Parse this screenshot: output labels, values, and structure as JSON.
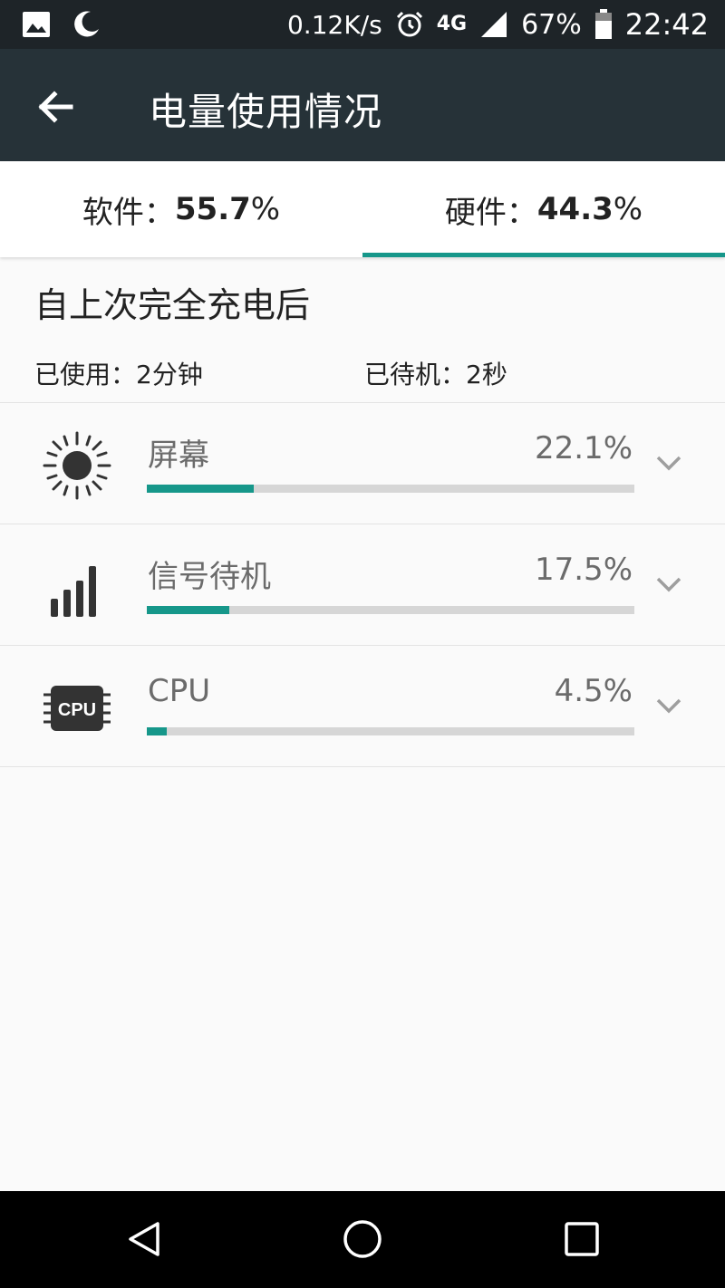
{
  "status_bar": {
    "net_speed": "0.12K/s",
    "network_type": "4G",
    "battery": "67%",
    "time": "22:42",
    "icons": [
      "image-icon",
      "moon-icon",
      "alarm-icon",
      "4g-icon",
      "signal-icon",
      "battery-icon"
    ]
  },
  "app_bar": {
    "title": "电量使用情况",
    "back_icon": "arrow-left-icon"
  },
  "tabs": [
    {
      "label": "软件：",
      "value": "55.7",
      "unit": "%",
      "selected": false
    },
    {
      "label": "硬件：",
      "value": "44.3",
      "unit": "%",
      "selected": true
    }
  ],
  "summary": {
    "title": "自上次完全充电后",
    "used": "已使用：2分钟",
    "standby": "已待机：2秒"
  },
  "items": [
    {
      "icon": "brightness-icon",
      "label": "屏幕",
      "percent_text": "22.1%",
      "bar_fraction": 0.22
    },
    {
      "icon": "signal-bars-icon",
      "label": "信号待机",
      "percent_text": "17.5%",
      "bar_fraction": 0.17
    },
    {
      "icon": "cpu-icon",
      "label": "CPU",
      "percent_text": "4.5%",
      "bar_fraction": 0.04
    }
  ],
  "nav_bar": {
    "icons": [
      "back-triangle-icon",
      "home-circle-icon",
      "recents-square-icon"
    ]
  },
  "colors": {
    "accent": "#16978a",
    "app_bar": "#263238",
    "status_bar": "#1e2428",
    "track": "#d6d6d6"
  }
}
